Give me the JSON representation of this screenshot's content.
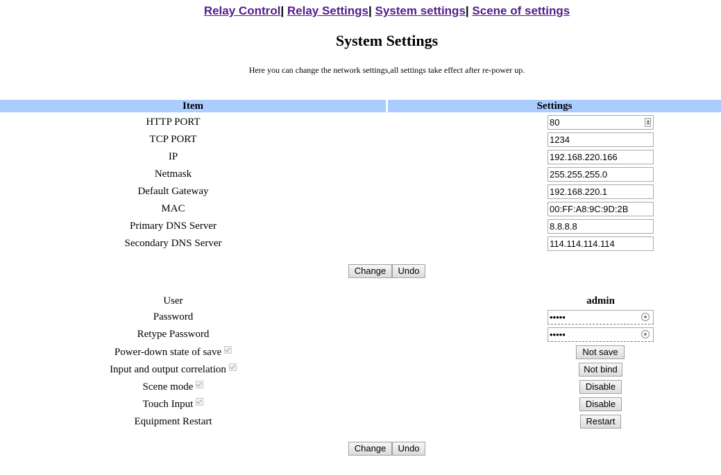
{
  "nav": {
    "links": [
      "Relay Control",
      "Relay Settings",
      "System settings",
      "Scene of settings"
    ],
    "separator": "|"
  },
  "page_title": "System Settings",
  "description": "Here you can change the network settings,all settings take effect after re-power up.",
  "table_header": {
    "item": "Item",
    "settings": "Settings"
  },
  "network": {
    "http_port": {
      "label": "HTTP PORT",
      "value": "80"
    },
    "tcp_port": {
      "label": "TCP PORT",
      "value": "1234"
    },
    "ip": {
      "label": "IP",
      "value": "192.168.220.166"
    },
    "netmask": {
      "label": "Netmask",
      "value": "255.255.255.0"
    },
    "gateway": {
      "label": "Default Gateway",
      "value": "192.168.220.1"
    },
    "mac": {
      "label": "MAC",
      "value": "00:FF:A8:9C:9D:2B"
    },
    "dns1": {
      "label": "Primary DNS Server",
      "value": "8.8.8.8"
    },
    "dns2": {
      "label": "Secondary DNS Server",
      "value": "114.114.114.114"
    }
  },
  "buttons": {
    "change": "Change",
    "undo": "Undo"
  },
  "account": {
    "user": {
      "label": "User",
      "value": "admin"
    },
    "password": {
      "label": "Password",
      "value": "•••••"
    },
    "retype_password": {
      "label": "Retype Password",
      "value": "•••••"
    }
  },
  "options": {
    "power_down": {
      "label": "Power-down state of save",
      "button": "Not save"
    },
    "io_correlation": {
      "label": "Input and output correlation",
      "button": "Not bind"
    },
    "scene_mode": {
      "label": "Scene mode",
      "button": "Disable"
    },
    "touch_input": {
      "label": "Touch Input",
      "button": "Disable"
    },
    "restart": {
      "label": "Equipment Restart",
      "button": "Restart"
    }
  }
}
